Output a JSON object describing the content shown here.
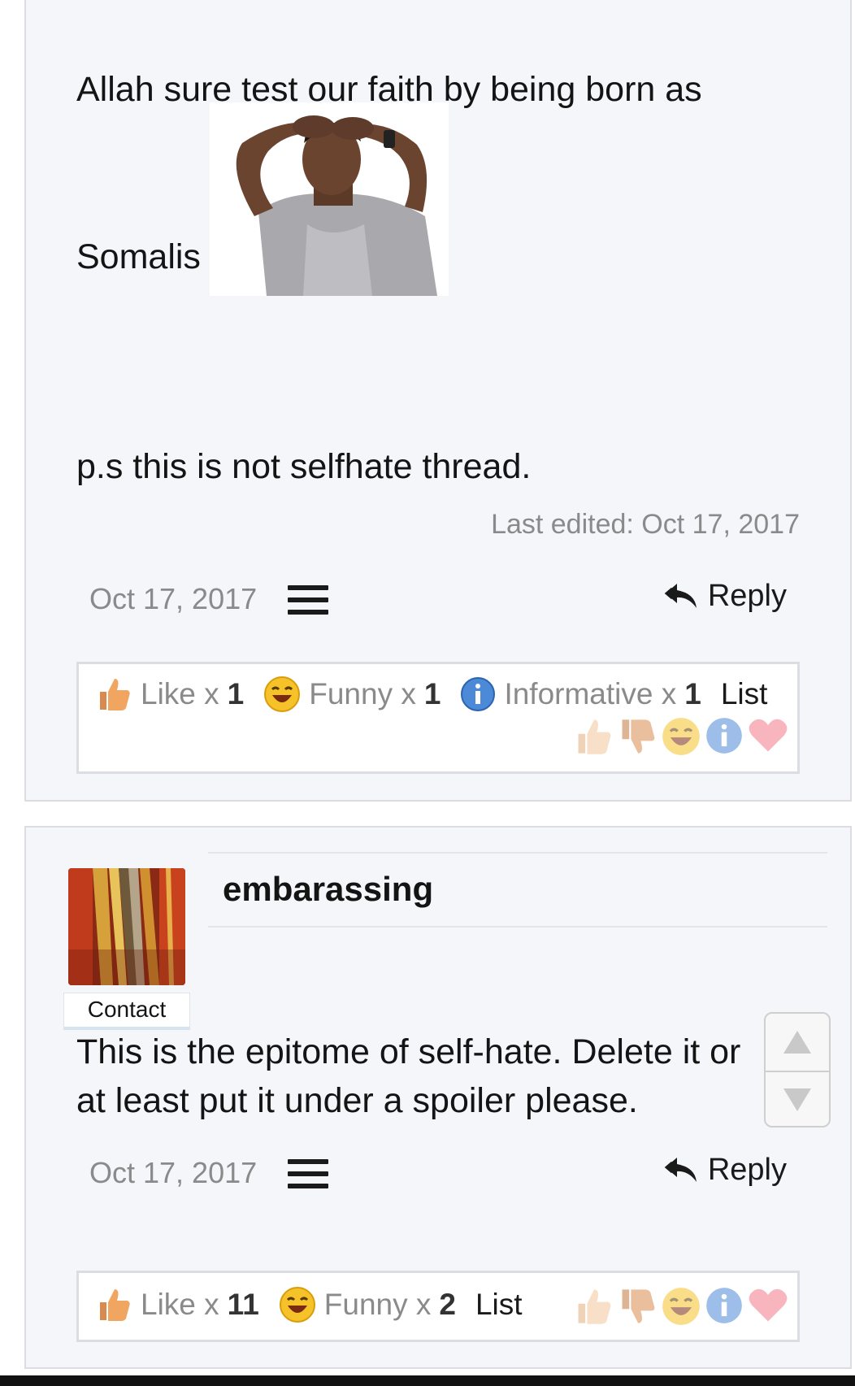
{
  "post1": {
    "text_line1": "Allah sure test our faith by being born as",
    "text_somalis": "Somalis",
    "text_ps": "p.s this is not selfhate thread.",
    "last_edited": "Last edited: Oct 17, 2017",
    "date": "Oct 17, 2017",
    "reply_label": "Reply",
    "reactions": [
      {
        "name": "Like x",
        "count": "1",
        "icon": "thumbs-up-icon"
      },
      {
        "name": "Funny x",
        "count": "1",
        "icon": "laughing-face-icon"
      },
      {
        "name": "Informative x",
        "count": "1",
        "icon": "info-icon"
      }
    ],
    "list_label": "List"
  },
  "post2": {
    "username": "embarassing",
    "contact_label": "Contact",
    "text": "This is the epitome of self-hate. Delete it or at least put it under a spoiler please.",
    "date": "Oct 17, 2017",
    "reply_label": "Reply",
    "reactions": [
      {
        "name": "Like x",
        "count": "11",
        "icon": "thumbs-up-icon"
      },
      {
        "name": "Funny x",
        "count": "2",
        "icon": "laughing-face-icon"
      }
    ],
    "list_label": "List"
  },
  "reaction_picker": [
    "thumbs-up-icon",
    "thumbs-down-icon",
    "laughing-face-icon",
    "info-icon",
    "heart-icon"
  ],
  "colors": {
    "post_bg": "#f5f6fa",
    "muted_text": "#8a8a8a",
    "border": "#dcdde3"
  }
}
